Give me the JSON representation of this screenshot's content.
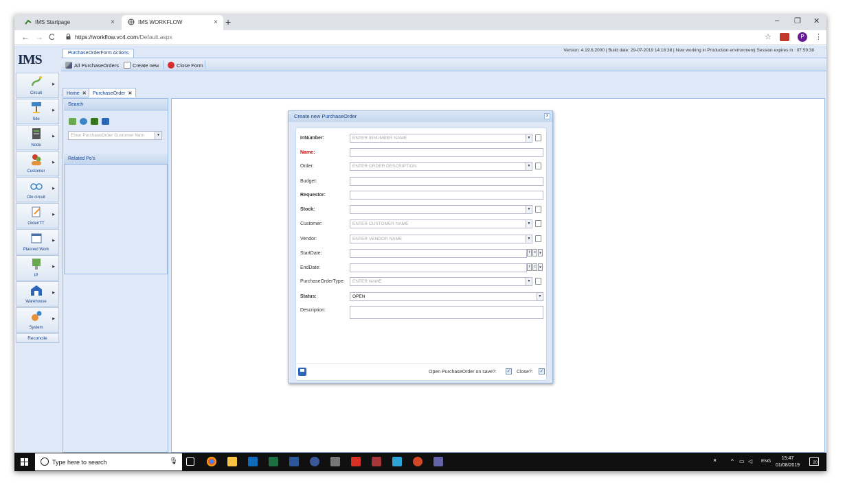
{
  "browser": {
    "tabs": [
      {
        "label": "IMS Startpage",
        "close": "×"
      },
      {
        "label": "IMS WORKFLOW",
        "close": "×"
      }
    ],
    "new_tab": "+",
    "window_controls": {
      "minimize": "–",
      "restore": "❐",
      "close": "✕"
    },
    "url_host": "https://workflow.vc4.com",
    "url_path": "/Default.aspx",
    "nav": {
      "back": "←",
      "forward": "→",
      "reload": "C"
    },
    "profile_letter": "P"
  },
  "app": {
    "logo": "IMS",
    "version_info": "Version: 4.19.6.2000 | Build date: 29-07-2019 14:18:38 | Now working in Production environment| Session expires in : 07:59:38",
    "actions_tab": "PurchaseOrderForm Actions",
    "toolbar": {
      "all_purchase_orders": "All PurchaseOrders",
      "create_new": "Create new",
      "close_form": "Close Form"
    },
    "sidebar": [
      {
        "label": "Circuit",
        "color": "#6aa84f"
      },
      {
        "label": "Site",
        "color": "#3d85c6"
      },
      {
        "label": "Node",
        "color": "#666666"
      },
      {
        "label": "Customer",
        "color": "#cc4125"
      },
      {
        "label": "Olo circuit",
        "color": "#3d85c6"
      },
      {
        "label": "Order/TT",
        "color": "#6d7fa0"
      },
      {
        "label": "Planned Work",
        "color": "#4a6fa5"
      },
      {
        "label": "IP",
        "color": "#6aa84f"
      },
      {
        "label": "Warehouse",
        "color": "#2b67b6"
      },
      {
        "label": "System",
        "color": "#e69138"
      }
    ],
    "reconcile": "Reconcile",
    "content_tabs": {
      "home": "Home",
      "purchase_order": "PurchaseOrder",
      "close": "✕"
    },
    "left_panel": {
      "search_title": "Search",
      "search_placeholder": "Enter PurchaseOrder Customer Nam",
      "related_title": "Related Po's"
    }
  },
  "modal": {
    "title": "Create new PurchaseOrder",
    "close": "x",
    "fields": {
      "innumber": {
        "label": "InNumber:",
        "placeholder": "ENTER INNUMBER NAME"
      },
      "name": {
        "label": "Name:"
      },
      "order": {
        "label": "Order:",
        "placeholder": "ENTER ORDER DESCRIPTION"
      },
      "budget": {
        "label": "Budget:"
      },
      "requestor": {
        "label": "Requestor:"
      },
      "stock": {
        "label": "Stock:"
      },
      "customer": {
        "label": "Customer:",
        "placeholder": "ENTER CUSTOMER NAME"
      },
      "vendor": {
        "label": "Vendor:",
        "placeholder": "ENTER VENDOR NAME"
      },
      "startdate": {
        "label": "StartDate:",
        "t": "t",
        "c": "c"
      },
      "enddate": {
        "label": "EndDate:",
        "t": "t",
        "c": "c"
      },
      "potype": {
        "label": "PurchaseOrderType:",
        "placeholder": "ENTER  NAME"
      },
      "status": {
        "label": "Status:",
        "value": "OPEN"
      },
      "description": {
        "label": "Description:"
      }
    },
    "dropdown_glyph": "▼",
    "footer": {
      "open_on_save": "Open PurchaseOrder on save?:",
      "close_label": "Close?:",
      "check": "✓"
    }
  },
  "taskbar": {
    "search_text": "Type here to search",
    "language": "ENG",
    "time": "15:47",
    "date": "01/08/2019",
    "notifications": "20"
  }
}
